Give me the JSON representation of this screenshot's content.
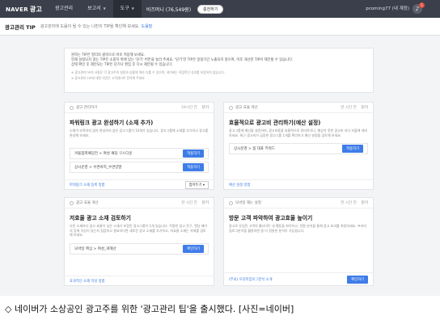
{
  "topbar": {
    "logo": "NAVER",
    "logo_suffix": "광고",
    "nav": [
      {
        "label": "광고관리",
        "active": false,
        "caret": false
      },
      {
        "label": "보고서",
        "active": false,
        "caret": true
      },
      {
        "label": "도구",
        "active": true,
        "caret": true
      }
    ],
    "money": "비즈머니 (76,549원)",
    "charge": "충전하기",
    "user": "pcoming77 (내 계정)",
    "notifications": "5"
  },
  "subhead": {
    "title": "광고관리 TIP",
    "desc": "광고관리에 도움이 될 수 있는 나만의 TIP을 확인해 보세요.",
    "help": "도움말"
  },
  "notice": {
    "lines": [
      "원하는 TIP은 멀리의 클릭으로 바로 적용해 보세요.",
      "현재 설정되지 않는 TIP은 소중하 위에 있는 '닫기' 버튼을 눌러 주세요. '닫기'한 TIP은 일정기간 노출되지 않으며, 이후 개선된 TIP이 제안될 수 있습니다.",
      "상태 확인 후 제안되는 TIP은 닫기나 편집 후 다시 제안될 수 있습니다."
    ],
    "sub": [
      "※ 광고관리TIP의 사용은 각 광고주의 설정과 상황에 따라 다를 수 있으며, 네이버는 직접적인 성과를 보장하지 않습니다.",
      "※ 광고관리 TIP에 대한 의견은 고객센터로 문의해 주세요."
    ]
  },
  "cards": [
    {
      "category": "광고 관리하기",
      "time": "24시간 전",
      "close": "닫기",
      "title": "파워링크 광고 완성하기 (소재 추가)",
      "desc": "소재가 부족하지 않아 완성하지 않은 광고그룹이 10개가 있습니다. 광고그룹에 소재를 추가하고 광고를 완성해 보세요.",
      "rows": [
        {
          "label": "겨울점퍼패딩전 > 여성 패딩 구스다운",
          "button": "적용하기"
        },
        {
          "label": "상시운영 > 수면바지_수면양말",
          "button": "적용하기"
        }
      ],
      "foot_link": "파워링크 소재 등록 방법",
      "foot_more": "접어두기"
    },
    {
      "category": "광고 효율 개선",
      "time": "한 시간 전",
      "close": "닫기",
      "title": "효율적으로 광고비 관리하기(예산 설정)",
      "desc": "광고그룹에 예산을 설정하여, 광고비용을 효율적으로 관리하거나, 예상치 못한 광고비 과다 지출에 대비하세요. 최근 광고비가 급증한 광고그룹 1개를 확인하고 예산 설정을 검토해 보세요.",
      "rows": [
        {
          "label": "상시운영 > 봄 대표 키워드",
          "button": "적용하기"
        }
      ],
      "foot_link": "예산 설정 방법",
      "foot_more": ""
    },
    {
      "category": "광고 효율 개선",
      "time": "한 시간 전",
      "close": "닫기",
      "title": "저효율 광고 소재 검토하기",
      "desc": "다른 소재보다 광고 효율이 낮은 소재가 포함된 광고그룹이 1개 있습니다. 적절한 광고 문구, 랜딩 페이지 등에 이상이 있는지 점검하고 필요하다면 새로운 광고 소재를 추가하고, 저효율 소재는 삭제를 검토해 보세요.",
      "rows": [
        {
          "label": "모바일 핵심 > 여성_게헤산",
          "button": "확인하기"
        }
      ],
      "foot_link": "효과적인 소재 작성 방법",
      "foot_more": ""
    },
    {
      "category": "모바일 해는 설정",
      "time": "한 시간 전",
      "close": "닫기",
      "title": "방문 고객 파악하여 광고효율 높이기",
      "desc": "광고로 유입된 고객의 웹사이트 내 행동을 파악하고, 전환 분석을 통해 광고 효과를 측정하세요. 프리미엄로그분석을 활용하면 좀 더 정밀한 분석이 가능합니다.",
      "rows": [],
      "foot_link": "(무료) 프리미엄로그분석 소개",
      "foot_button": "확인하기"
    }
  ],
  "caption": "◇ 네이버가 소상공인 광고주를 위한 '광고관리 팁'을 출시했다. [사진=네이버]"
}
